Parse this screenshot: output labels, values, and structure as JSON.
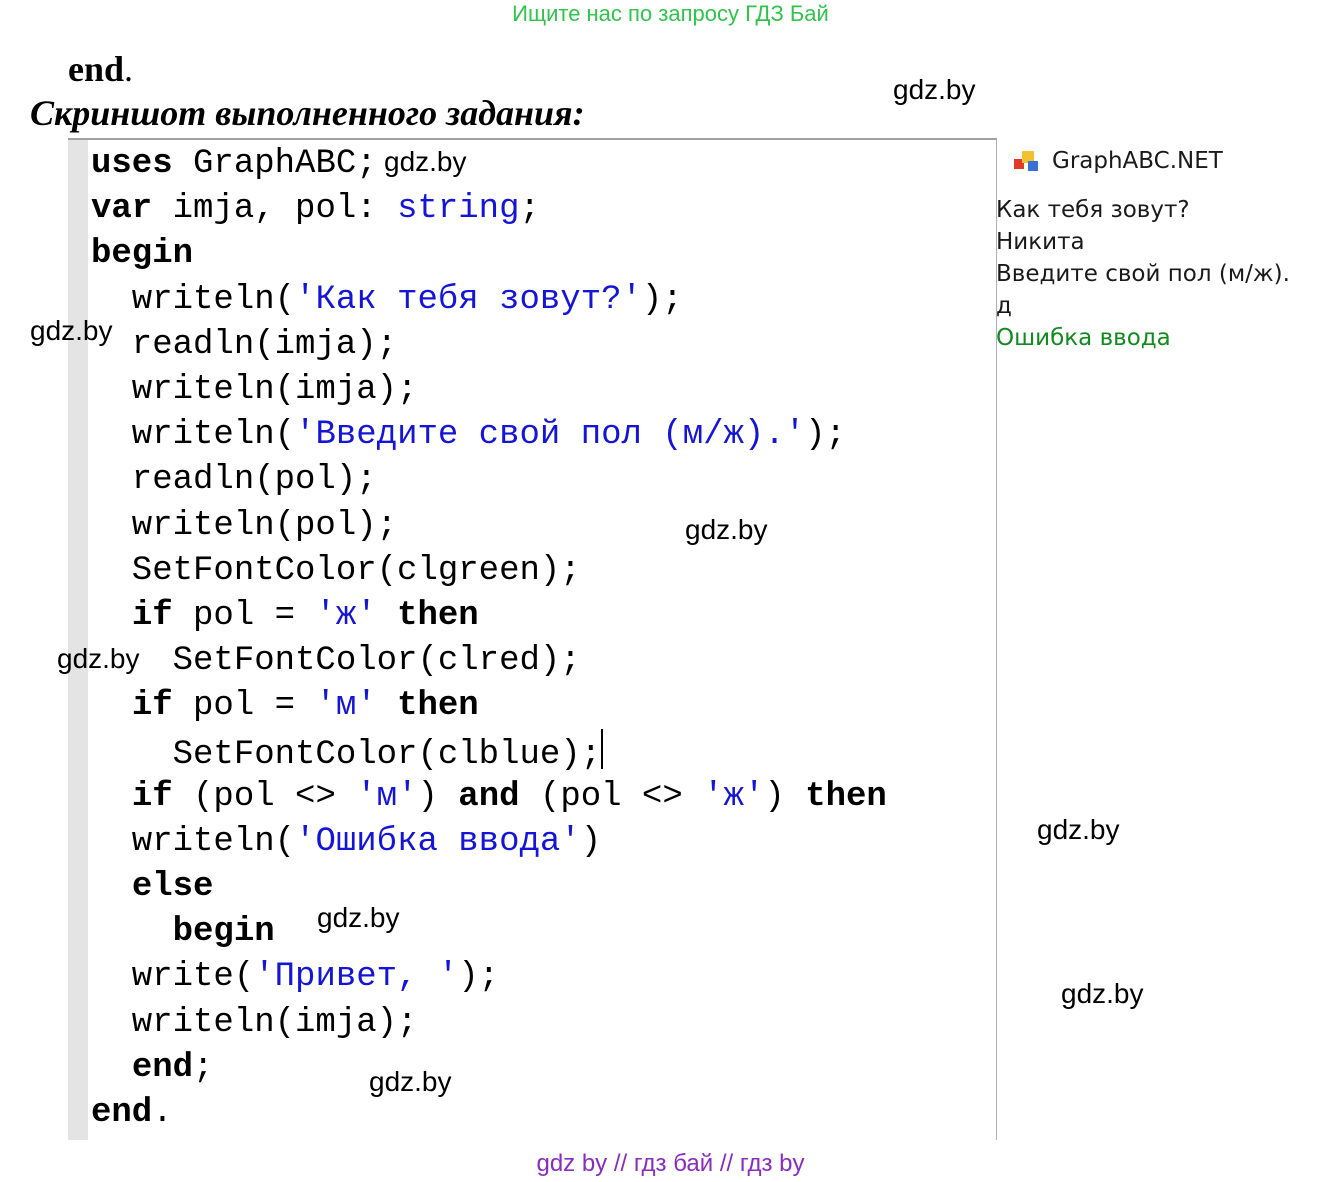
{
  "banner": "Ищите нас по запросу ГДЗ Бай",
  "heading_end": "end",
  "heading_end_dot": ".",
  "caption": "Скриншот выполненного задания:",
  "watermark": "gdz.by",
  "editor": {
    "lines": [
      [
        {
          "t": "uses",
          "c": "kw"
        },
        {
          "t": " GraphABC;"
        }
      ],
      [
        {
          "t": "var",
          "c": "kw"
        },
        {
          "t": " imja, pol: "
        },
        {
          "t": "string",
          "c": "ty"
        },
        {
          "t": ";"
        }
      ],
      [
        {
          "t": "begin",
          "c": "kw"
        }
      ],
      [
        {
          "t": "  writeln("
        },
        {
          "t": "'Как тебя зовут?'",
          "c": "str"
        },
        {
          "t": ");"
        }
      ],
      [
        {
          "t": "  readln(imja);"
        }
      ],
      [
        {
          "t": "  writeln(imja);"
        }
      ],
      [
        {
          "t": "  writeln("
        },
        {
          "t": "'Введите свой пол (м/ж).'",
          "c": "str"
        },
        {
          "t": ");"
        }
      ],
      [
        {
          "t": "  readln(pol);"
        }
      ],
      [
        {
          "t": "  writeln(pol);"
        }
      ],
      [
        {
          "t": "  SetFontColor(clgreen);"
        }
      ],
      [
        {
          "t": "  "
        },
        {
          "t": "if",
          "c": "kw"
        },
        {
          "t": " pol = "
        },
        {
          "t": "'ж'",
          "c": "str"
        },
        {
          "t": " "
        },
        {
          "t": "then",
          "c": "kw"
        }
      ],
      [
        {
          "t": "    SetFontColor(clred);"
        }
      ],
      [
        {
          "t": "  "
        },
        {
          "t": "if",
          "c": "kw"
        },
        {
          "t": " pol = "
        },
        {
          "t": "'м'",
          "c": "str"
        },
        {
          "t": " "
        },
        {
          "t": "then",
          "c": "kw"
        }
      ],
      [
        {
          "t": "    SetFontColor(clblue);"
        },
        {
          "t": "",
          "c": "caret"
        }
      ],
      [
        {
          "t": "  "
        },
        {
          "t": "if",
          "c": "kw"
        },
        {
          "t": " (pol <> "
        },
        {
          "t": "'м'",
          "c": "str"
        },
        {
          "t": ") "
        },
        {
          "t": "and",
          "c": "kw"
        },
        {
          "t": " (pol <> "
        },
        {
          "t": "'ж'",
          "c": "str"
        },
        {
          "t": ") "
        },
        {
          "t": "then",
          "c": "kw"
        }
      ],
      [
        {
          "t": "  writeln("
        },
        {
          "t": "'Ошибка ввода'",
          "c": "str"
        },
        {
          "t": ")"
        }
      ],
      [
        {
          "t": "  "
        },
        {
          "t": "else",
          "c": "kw"
        }
      ],
      [
        {
          "t": "    "
        },
        {
          "t": "begin",
          "c": "kw"
        }
      ],
      [
        {
          "t": "  write("
        },
        {
          "t": "'Привет, '",
          "c": "str"
        },
        {
          "t": ");"
        }
      ],
      [
        {
          "t": "  writeln(imja);"
        }
      ],
      [
        {
          "t": "  "
        },
        {
          "t": "end",
          "c": "kw"
        },
        {
          "t": ";"
        }
      ],
      [
        {
          "t": "end",
          "c": "kw"
        },
        {
          "t": "."
        }
      ]
    ]
  },
  "output_window": {
    "title": "GraphABC.NET",
    "icon": "graphabc-app-icon",
    "lines": [
      {
        "text": "Как тебя зовут?",
        "color": "default"
      },
      {
        "text": "Никита",
        "color": "default"
      },
      {
        "text": "Введите свой пол (м/ж).",
        "color": "default"
      },
      {
        "text": "д",
        "color": "default"
      },
      {
        "text": "Ошибка ввода",
        "color": "#118a1e"
      }
    ]
  },
  "footer": "gdz by  //  гдз бай  //  гдз by"
}
